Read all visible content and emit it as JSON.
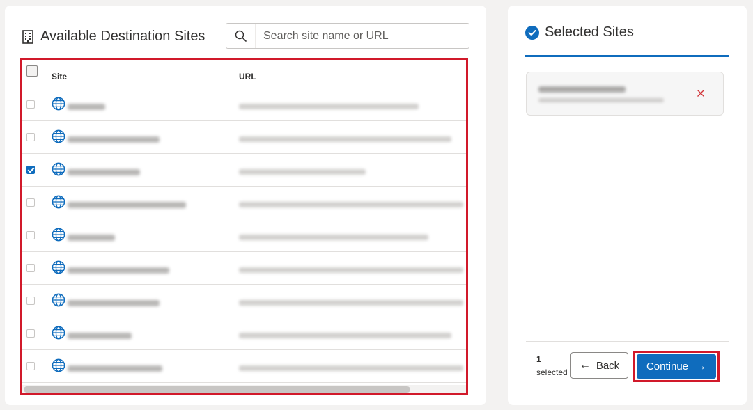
{
  "available": {
    "title": "Available Destination Sites",
    "search_placeholder": "Search site name or URL",
    "columns": {
      "site": "Site",
      "url": "URL"
    },
    "rows": [
      {
        "checked": false
      },
      {
        "checked": false
      },
      {
        "checked": true
      },
      {
        "checked": false
      },
      {
        "checked": false
      },
      {
        "checked": false
      },
      {
        "checked": false
      },
      {
        "checked": false
      },
      {
        "checked": false
      },
      {
        "checked": false
      }
    ]
  },
  "selected": {
    "title": "Selected Sites",
    "count": "1",
    "count_label": "selected",
    "back_label": "Back",
    "continue_label": "Continue"
  },
  "icons": {
    "title_icon": "building-icon",
    "search": "search-icon",
    "row": "globe-icon",
    "selected_title": "check-circle-icon",
    "remove": "close-icon",
    "back": "arrow-left-icon",
    "continue": "arrow-right-icon"
  },
  "colors": {
    "accent": "#0f6cbd",
    "highlight": "#d1192a",
    "remove": "#d13438"
  }
}
